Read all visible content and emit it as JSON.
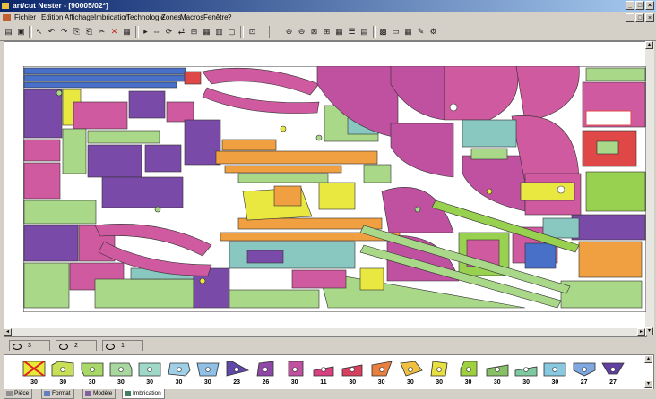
{
  "window": {
    "title": "art/cut Nester - [90005/02*]"
  },
  "menu": [
    "Fichier",
    "Edition",
    "Affichage",
    "Imbrication",
    "Technologie",
    "Zones",
    "Macros",
    "Fenêtre",
    "?"
  ],
  "sheet_tabs": [
    {
      "label": "3"
    },
    {
      "label": "2"
    },
    {
      "label": "1"
    }
  ],
  "parts": [
    {
      "count": "30",
      "icon": "rejected-part-icon",
      "color": "#e8e838"
    },
    {
      "count": "30",
      "icon": "part-shape-icon",
      "color": "#c8e058"
    },
    {
      "count": "30",
      "icon": "part-shape-icon",
      "color": "#a8d868"
    },
    {
      "count": "30",
      "icon": "part-shape-icon",
      "color": "#a8d8a0"
    },
    {
      "count": "30",
      "icon": "part-shape-icon",
      "color": "#a0d8c8"
    },
    {
      "count": "30",
      "icon": "part-shape-icon",
      "color": "#a0d0e8"
    },
    {
      "count": "30",
      "icon": "part-shape-icon",
      "color": "#90c0e8"
    },
    {
      "count": "23",
      "icon": "part-shape-icon",
      "color": "#6048a8"
    },
    {
      "count": "26",
      "icon": "part-shape-icon",
      "color": "#9048a8"
    },
    {
      "count": "30",
      "icon": "part-shape-icon",
      "color": "#c050a0"
    },
    {
      "count": "11",
      "icon": "part-shape-icon",
      "color": "#d84080"
    },
    {
      "count": "30",
      "icon": "part-shape-icon",
      "color": "#d84060"
    },
    {
      "count": "30",
      "icon": "part-shape-icon",
      "color": "#e88040"
    },
    {
      "count": "30",
      "icon": "part-shape-icon",
      "color": "#f0c040"
    },
    {
      "count": "30",
      "icon": "part-shape-icon",
      "color": "#e8e040"
    },
    {
      "count": "30",
      "icon": "part-shape-icon",
      "color": "#a0d040"
    },
    {
      "count": "30",
      "icon": "part-shape-icon",
      "color": "#88c068"
    },
    {
      "count": "30",
      "icon": "part-shape-icon",
      "color": "#80c8a0"
    },
    {
      "count": "30",
      "icon": "part-shape-icon",
      "color": "#88c8e0"
    },
    {
      "count": "27",
      "icon": "part-shape-icon",
      "color": "#80a8e0"
    },
    {
      "count": "27",
      "icon": "part-shape-icon",
      "color": "#6040a0"
    }
  ],
  "bottom_tabs": [
    {
      "label": "Pièce",
      "icon": "part-tab-icon"
    },
    {
      "label": "Format",
      "icon": "format-tab-icon"
    },
    {
      "label": "Modèle",
      "icon": "model-tab-icon"
    },
    {
      "label": "Imbrication",
      "icon": "nesting-tab-icon"
    }
  ],
  "colors": {
    "pink": "#d05aa0",
    "purple": "#7a4aa8",
    "green": "#a8d888",
    "yellow": "#e8e840",
    "orange": "#f0a040",
    "teal": "#88c8c0",
    "magenta": "#c050a0",
    "blue": "#4870c8",
    "red": "#e04848",
    "lime": "#98d050"
  }
}
